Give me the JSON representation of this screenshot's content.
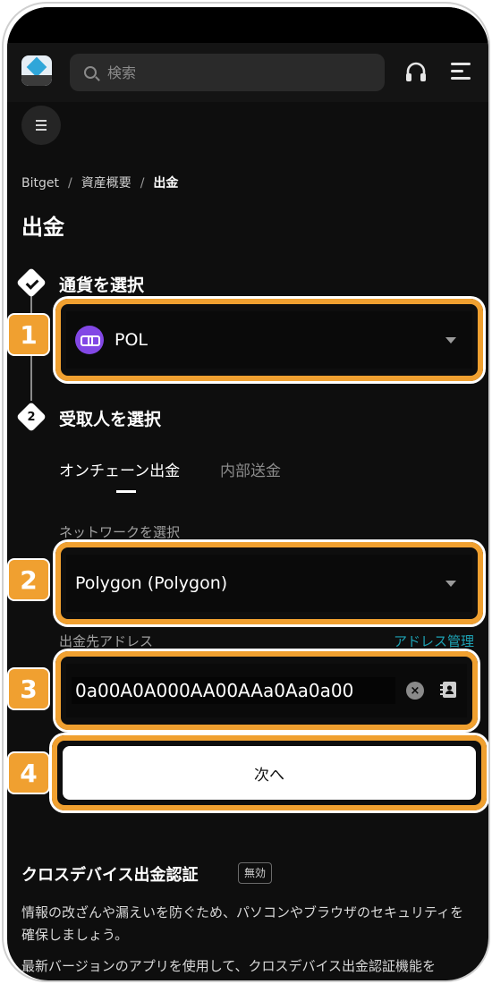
{
  "header": {
    "search_placeholder": "検索"
  },
  "breadcrumb": {
    "items": [
      "Bitget",
      "資産概要"
    ],
    "current": "出金"
  },
  "page": {
    "title": "出金"
  },
  "steps": {
    "step1": {
      "title": "通貨を選択"
    },
    "step2": {
      "number": "2",
      "title": "受取人を選択"
    }
  },
  "coin_select": {
    "value": "POL"
  },
  "tabs": [
    {
      "label": "オンチェーン出金",
      "active": true
    },
    {
      "label": "内部送金",
      "active": false
    }
  ],
  "network": {
    "label": "ネットワークを選択",
    "value": "Polygon (Polygon)"
  },
  "address": {
    "label": "出金先アドレス",
    "manage_label": "アドレス管理",
    "value": "0a00A0A000AA00AAa0Aa0a00"
  },
  "next_button": {
    "label": "次へ"
  },
  "annotations": [
    "1",
    "2",
    "3",
    "4"
  ],
  "cross_device": {
    "title": "クロスデバイス出金認証",
    "status": "無効",
    "para1": "情報の改ざんや漏えいを防ぐため、パソコンやブラウザのセキュリティを確保しましょう。",
    "para2": "最新バージョンのアプリを使用して、クロスデバイス出金認証機能を"
  },
  "colors": {
    "highlight": "#f0a030",
    "accent_link": "#1da2b4",
    "polygon": "#8247e5"
  }
}
